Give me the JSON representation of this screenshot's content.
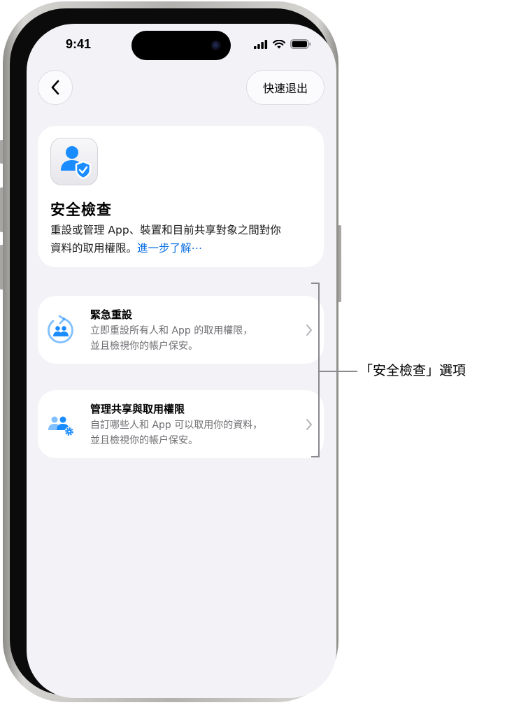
{
  "status_bar": {
    "time": "9:41"
  },
  "nav": {
    "quick_exit_label": "快速退出"
  },
  "intro": {
    "title": "安全檢查",
    "description_line1": "重設或管理 App、裝置和目前共享對象之間對你",
    "description_line2": "資料的取用權限。",
    "learn_more_link": "進一步了解⋯"
  },
  "options": [
    {
      "title": "緊急重設",
      "line1": "立即重設所有人和 App 的取用權限，",
      "line2": "並且檢視你的帳户保安。",
      "icon": "emergency-reset-icon"
    },
    {
      "title": "管理共享與取用權限",
      "line1": "自訂哪些人和 App 可以取用你的資料，",
      "line2": "並且檢視你的帳户保安。",
      "icon": "manage-sharing-icon"
    }
  ],
  "annotation": {
    "callout": "「安全檢查」選項"
  },
  "colors": {
    "accent": "#0a6fe0",
    "icon_blue": "#1a8cff"
  }
}
